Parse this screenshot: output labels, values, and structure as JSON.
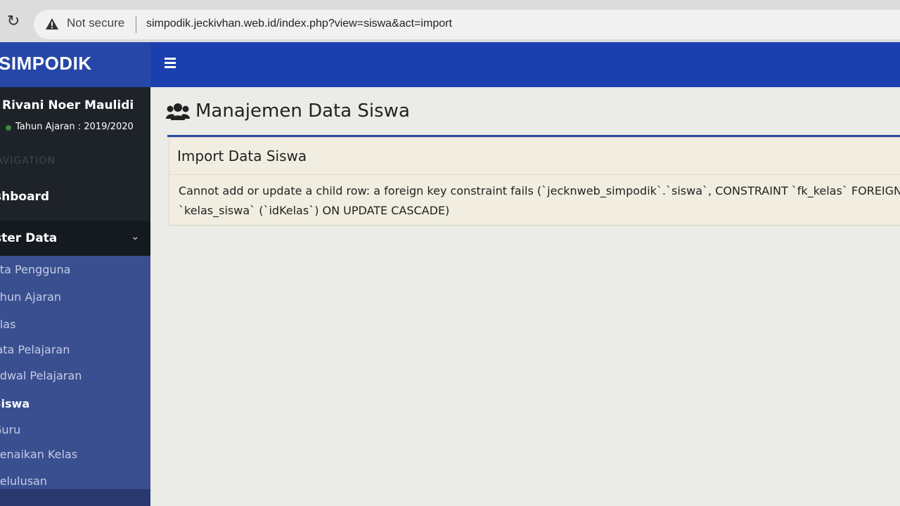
{
  "browser": {
    "security_label": "Not secure",
    "url": "simpodik.jeckivhan.web.id/index.php?view=siswa&act=import"
  },
  "app": {
    "brand": "SIMPODIK"
  },
  "user": {
    "name": "Rivani Noer Maulidi",
    "year_label": "Tahun Ajaran : 2019/2020"
  },
  "sidebar": {
    "header": "AVIGATION",
    "dashboard": "shboard",
    "master": "ster Data",
    "items": [
      {
        "label": "ata Pengguna"
      },
      {
        "label": "ahun Ajaran"
      },
      {
        "label": "elas"
      },
      {
        "label": "lata Pelajaran"
      },
      {
        "label": "adwal Pelajaran"
      },
      {
        "label": "Siswa"
      },
      {
        "label": "Guru"
      },
      {
        "label": "Kenaikan Kelas"
      },
      {
        "label": "Kelulusan"
      }
    ]
  },
  "main": {
    "title": "Manajemen Data Siswa",
    "panel_title": "Import Data Siswa",
    "error_line1": "Cannot add or update a child row: a foreign key constraint fails (`jecknweb_simpodik`.`siswa`, CONSTRAINT `fk_kelas` FOREIGN",
    "error_line2": "`kelas_siswa` (`idKelas`) ON UPDATE CASCADE)"
  },
  "colors": {
    "navbar": "#1b3fae",
    "brand": "#2747a8",
    "sidebar": "#1e2329",
    "submenu": "#3a4f8f",
    "panel": "#f1eee1"
  }
}
